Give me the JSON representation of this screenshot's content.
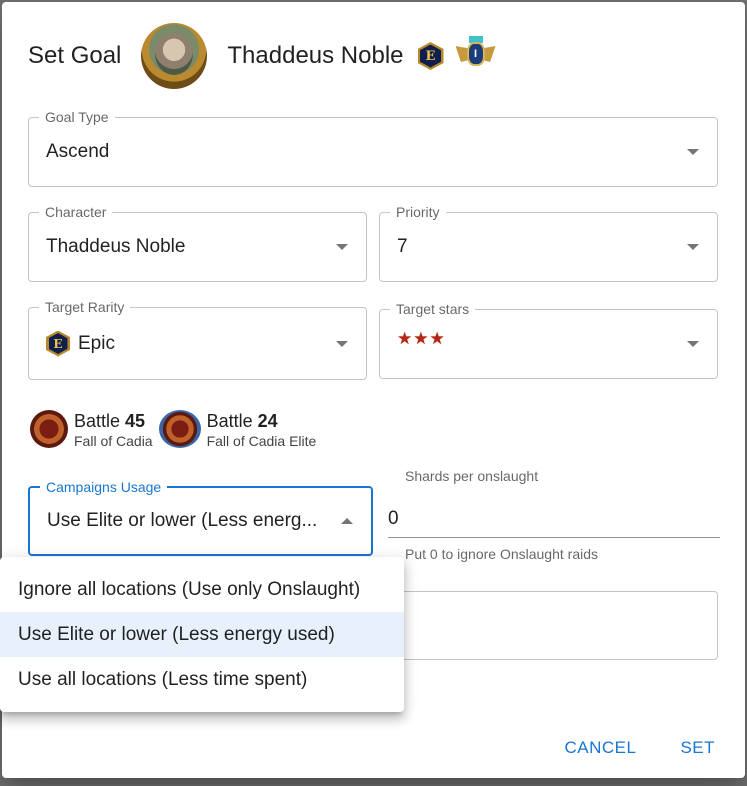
{
  "dialog": {
    "title": "Set Goal",
    "character_name": "Thaddeus Noble",
    "rarity_letter": "E",
    "rank_letter": "I"
  },
  "goal_type": {
    "label": "Goal Type",
    "value": "Ascend"
  },
  "character": {
    "label": "Character",
    "value": "Thaddeus Noble"
  },
  "priority": {
    "label": "Priority",
    "value": "7"
  },
  "target_rarity": {
    "label": "Target Rarity",
    "value": "Epic",
    "icon_letter": "E"
  },
  "target_stars": {
    "label": "Target stars",
    "stars": 3
  },
  "battles": [
    {
      "prefix": "Battle",
      "number": "45",
      "campaign": "Fall of Cadia"
    },
    {
      "prefix": "Battle",
      "number": "24",
      "campaign": "Fall of Cadia Elite"
    }
  ],
  "campaigns_usage": {
    "label": "Campaigns Usage",
    "value": "Use Elite or lower (Less energ...",
    "options": [
      "Ignore all locations (Use only Onslaught)",
      "Use Elite or lower (Less energy used)",
      "Use all locations (Less time spent)"
    ],
    "selected_index": 1
  },
  "shards_per_onslaught": {
    "label": "Shards per onslaught",
    "value": "0",
    "helper": "Put 0 to ignore Onslaught raids"
  },
  "actions": {
    "cancel": "CANCEL",
    "set": "SET"
  },
  "colors": {
    "accent": "#1976d2",
    "selected_bg": "#e8f1fb",
    "star": "#b3261e"
  }
}
